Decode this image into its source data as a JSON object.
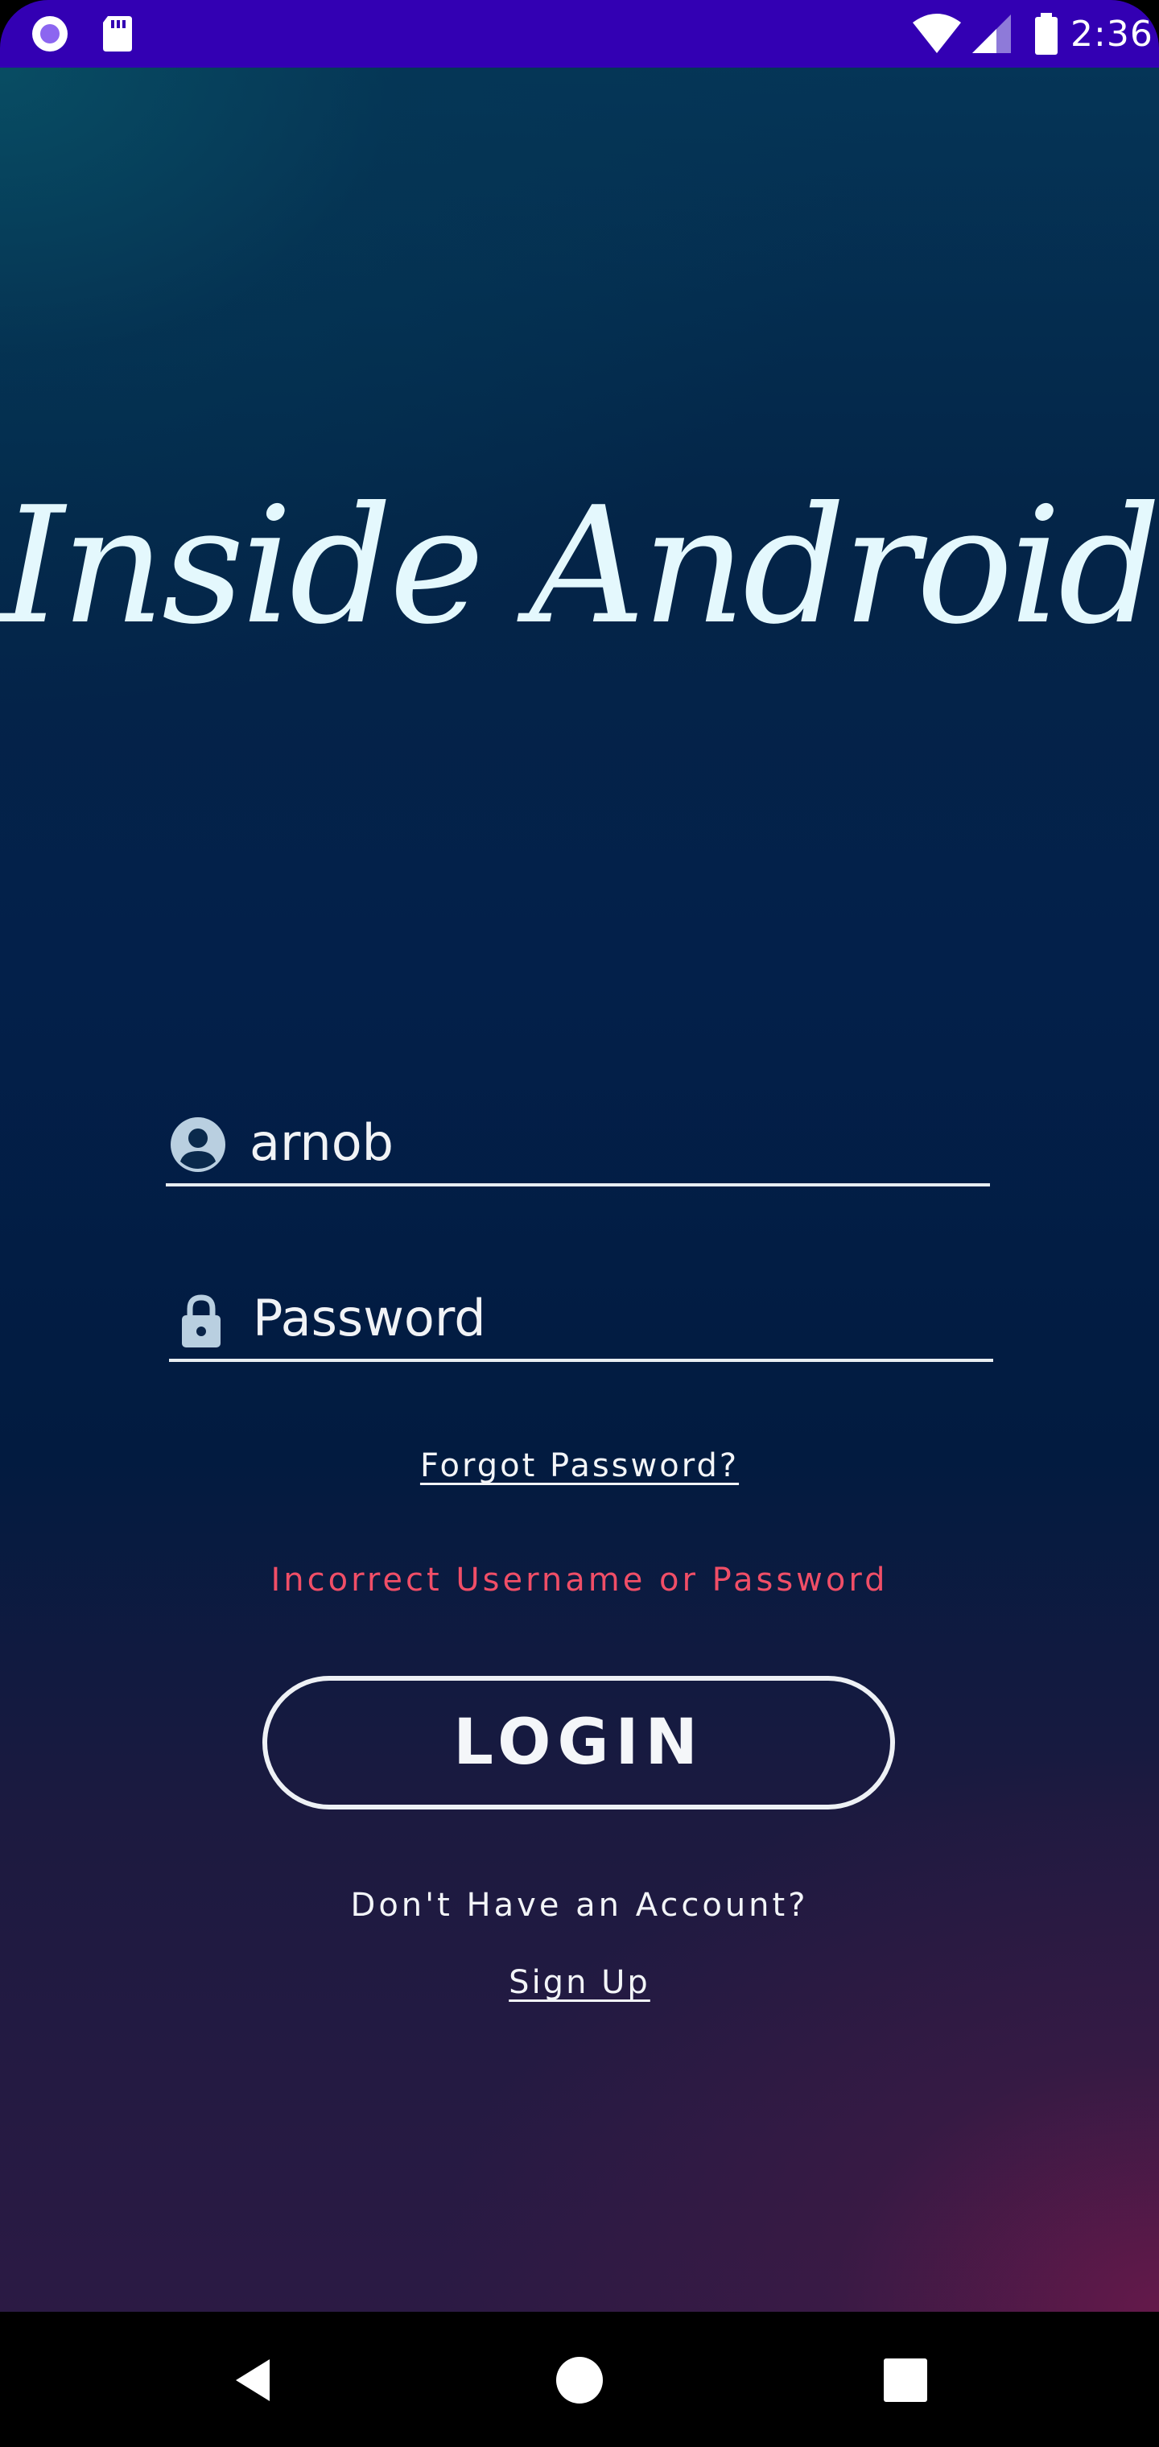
{
  "status_bar": {
    "time": "2:36",
    "background_color": "#3300b3",
    "left_icons": [
      "record-icon",
      "sd-card-icon"
    ],
    "right_icons": [
      "wifi-icon",
      "cell-signal-icon",
      "battery-icon"
    ]
  },
  "app": {
    "title": "Inside Android",
    "username_field": {
      "icon": "account-circle-icon",
      "value": "arnob"
    },
    "password_field": {
      "icon": "lock-icon",
      "placeholder": "Password"
    },
    "forgot_password_label": "Forgot Password?",
    "error_message": "Incorrect Username or Password",
    "error_color": "#f04e67",
    "login_label": "LOGIN",
    "no_account_label": "Don't Have an Account?",
    "signup_label": "Sign Up"
  },
  "nav_bar": {
    "buttons": [
      "back-icon",
      "home-icon",
      "recents-icon"
    ]
  }
}
